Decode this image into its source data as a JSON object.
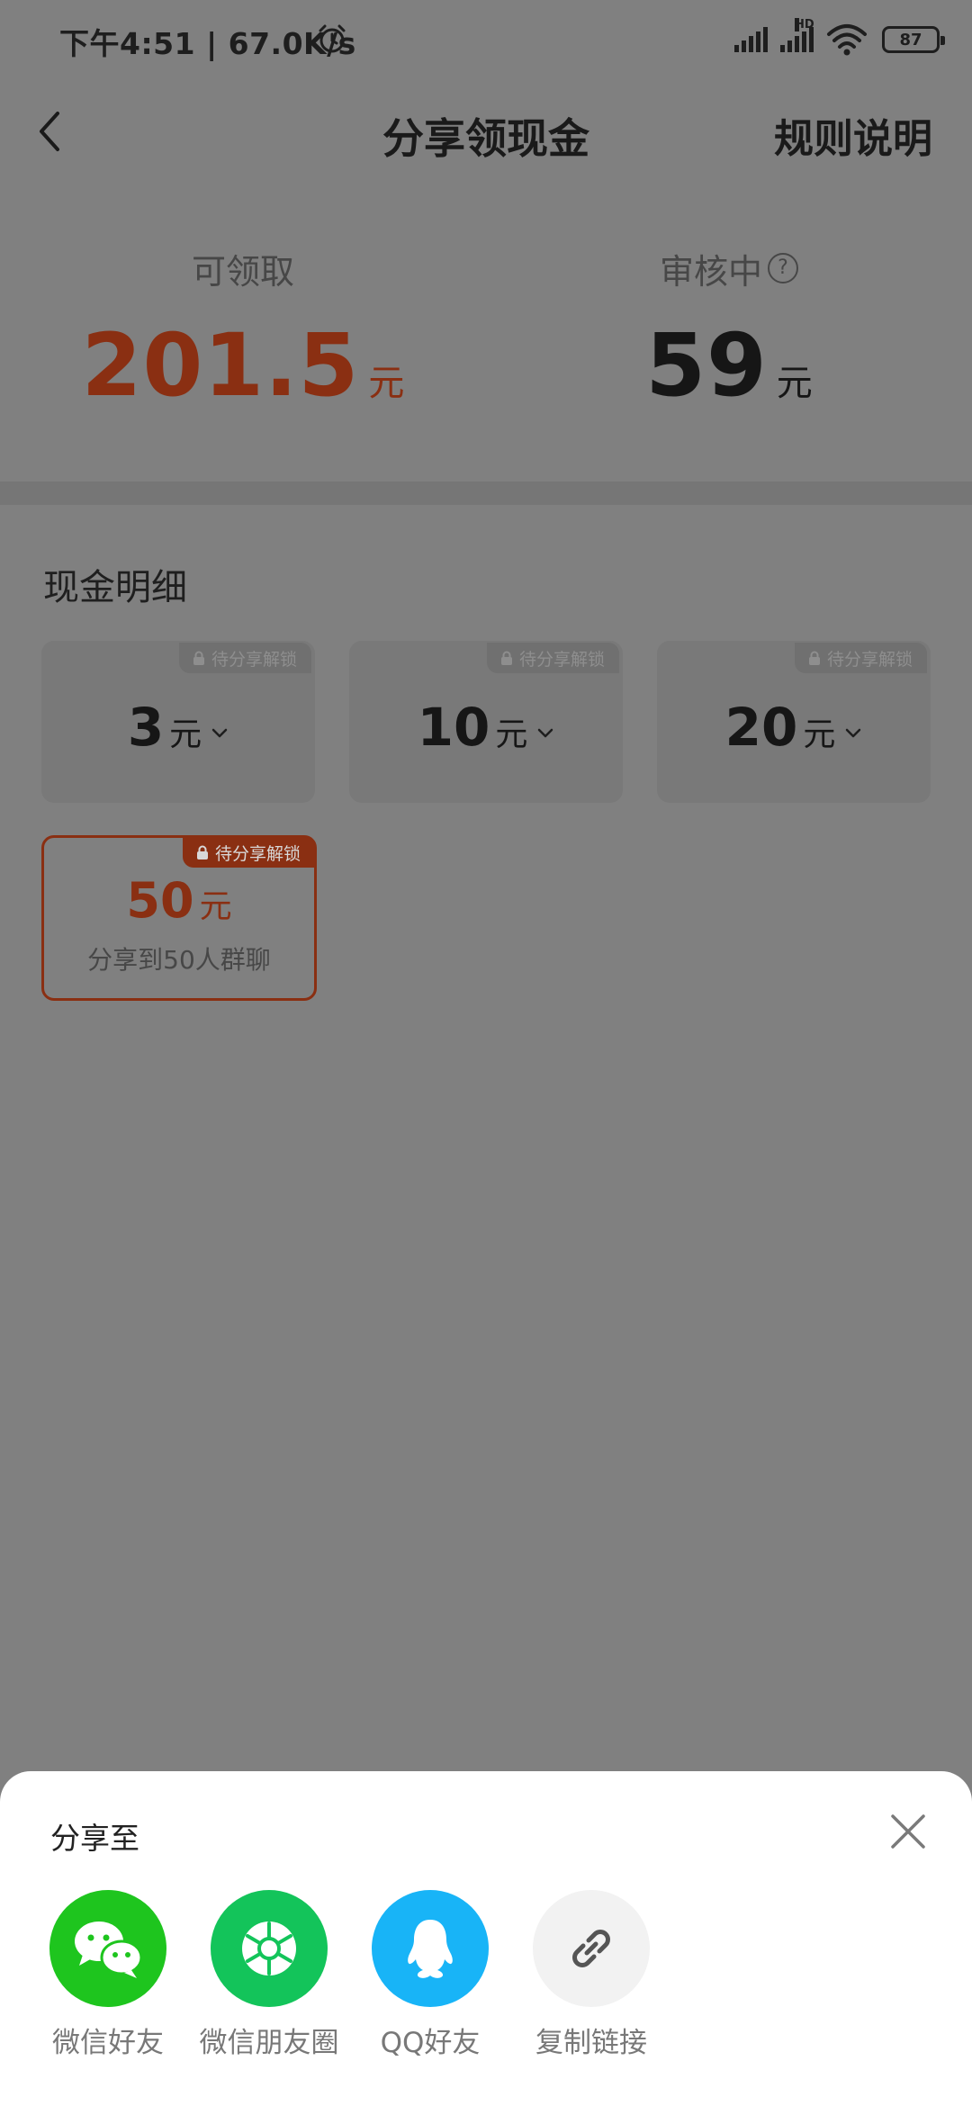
{
  "status_bar": {
    "time_speed": "下午4:51 | 67.0K/s",
    "hd": "HD",
    "battery": "87"
  },
  "nav": {
    "title": "分享领现金",
    "rules": "规则说明"
  },
  "summary": {
    "available_label": "可领取",
    "available_value": "201.5",
    "available_unit": "元",
    "reviewing_label": "审核中",
    "reviewing_help": "?",
    "reviewing_value": "59",
    "reviewing_unit": "元"
  },
  "section": {
    "title": "现金明细"
  },
  "cards": [
    {
      "tag": "待分享解锁",
      "amount": "3",
      "unit": "元"
    },
    {
      "tag": "待分享解锁",
      "amount": "10",
      "unit": "元"
    },
    {
      "tag": "待分享解锁",
      "amount": "20",
      "unit": "元"
    }
  ],
  "active_card": {
    "tag": "待分享解锁",
    "amount": "50",
    "unit": "元",
    "desc": "分享到50人群聊"
  },
  "share": {
    "title": "分享至",
    "items": [
      {
        "label": "微信好友",
        "icon": "wechat-icon",
        "color": "#1ec51e"
      },
      {
        "label": "微信朋友圈",
        "icon": "moments-icon",
        "color": "#13c45a"
      },
      {
        "label": "QQ好友",
        "icon": "qq-icon",
        "color": "#18b4f7"
      },
      {
        "label": "复制链接",
        "icon": "link-icon",
        "color": "#f2f2f2"
      }
    ]
  },
  "colors": {
    "accent_red": "#8a2f12",
    "overlay_gray": "#808080"
  }
}
